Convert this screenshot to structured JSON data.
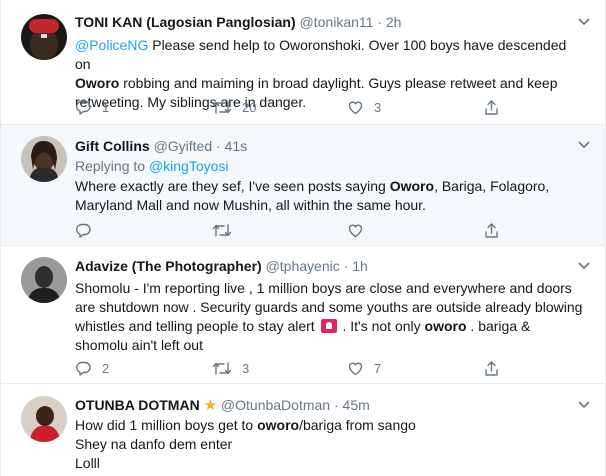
{
  "tweets": [
    {
      "name": "TONI KAN (Lagosian Panglosian)",
      "handle": "@tonikan11",
      "dot": "·",
      "time": "2h",
      "reply_prefix": "",
      "reply_to": "",
      "lines": [
        [
          "@PoliceNG",
          " Please send help to Oworonshoki. Over 100 boys have descended on"
        ],
        [
          "Oworo",
          " robbing and maiming in broad daylight. Guys please retweet and keep"
        ],
        [
          "retweeting. My siblings are in danger."
        ]
      ],
      "reply_count": "1",
      "retweet_count": "20",
      "like_count": "3"
    },
    {
      "name": "Gift Collins",
      "handle": "@Gyifted",
      "dot": "·",
      "time": "41s",
      "reply_prefix": "Replying to ",
      "reply_to": "@kingToyosi",
      "line1_pre": "Where exactly are they sef, I've seen posts saying ",
      "line1_bold": "Oworo",
      "line1_post": ", Bariga, Folagoro,",
      "line2": "Maryland Mall and now Mushin, all within the same hour.",
      "reply_count": "",
      "retweet_count": "",
      "like_count": ""
    },
    {
      "name": "Adavize (The Photographer)",
      "handle": "@tphayenic",
      "dot": "·",
      "time": "1h",
      "line1": "Shomolu - I'm reporting live , 1 million boys are close and everywhere and doors",
      "line2": "are shutdown now .  Security guards and some youths are outside already blowing",
      "line3_pre": "whistles and telling people to stay alert",
      "line3_mid": " . It's not only ",
      "line3_bold": "oworo",
      "line3_post": " . bariga &",
      "line4": "shomolu ain't left out",
      "emoji": "police-light-emoji",
      "reply_count": "2",
      "retweet_count": "3",
      "like_count": "7"
    },
    {
      "name": "OTUNBA DOTMAN",
      "handle": "@OtunbaDotman",
      "dot": "·",
      "time": "45m",
      "star": "★",
      "line1_pre": "How did 1 million boys get to ",
      "line1_bold": "oworo",
      "line1_post": "/bariga from sango",
      "line2": "Shey na danfo dem enter",
      "line3": "Lolll"
    }
  ],
  "colors": {
    "accent": "#1da1f2",
    "muted": "#657786",
    "text": "#14171a",
    "highlight_bg": "#f5f8fa",
    "border": "#e6ecf0",
    "star": "#ffad1f"
  },
  "icons": {
    "reply": "reply-icon",
    "retweet": "retweet-icon",
    "like": "heart-icon",
    "share": "share-icon",
    "caret": "chevron-down-icon"
  }
}
